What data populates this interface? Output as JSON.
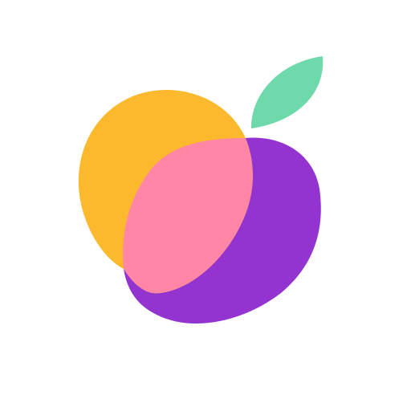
{
  "logo": {
    "name": "fruit-logo",
    "colors": {
      "background": "#ffffff",
      "yellow": "#FCB92D",
      "purple": "#9334D1",
      "overlap": "#FF86A4",
      "leaf": "#6EDAAC"
    }
  }
}
